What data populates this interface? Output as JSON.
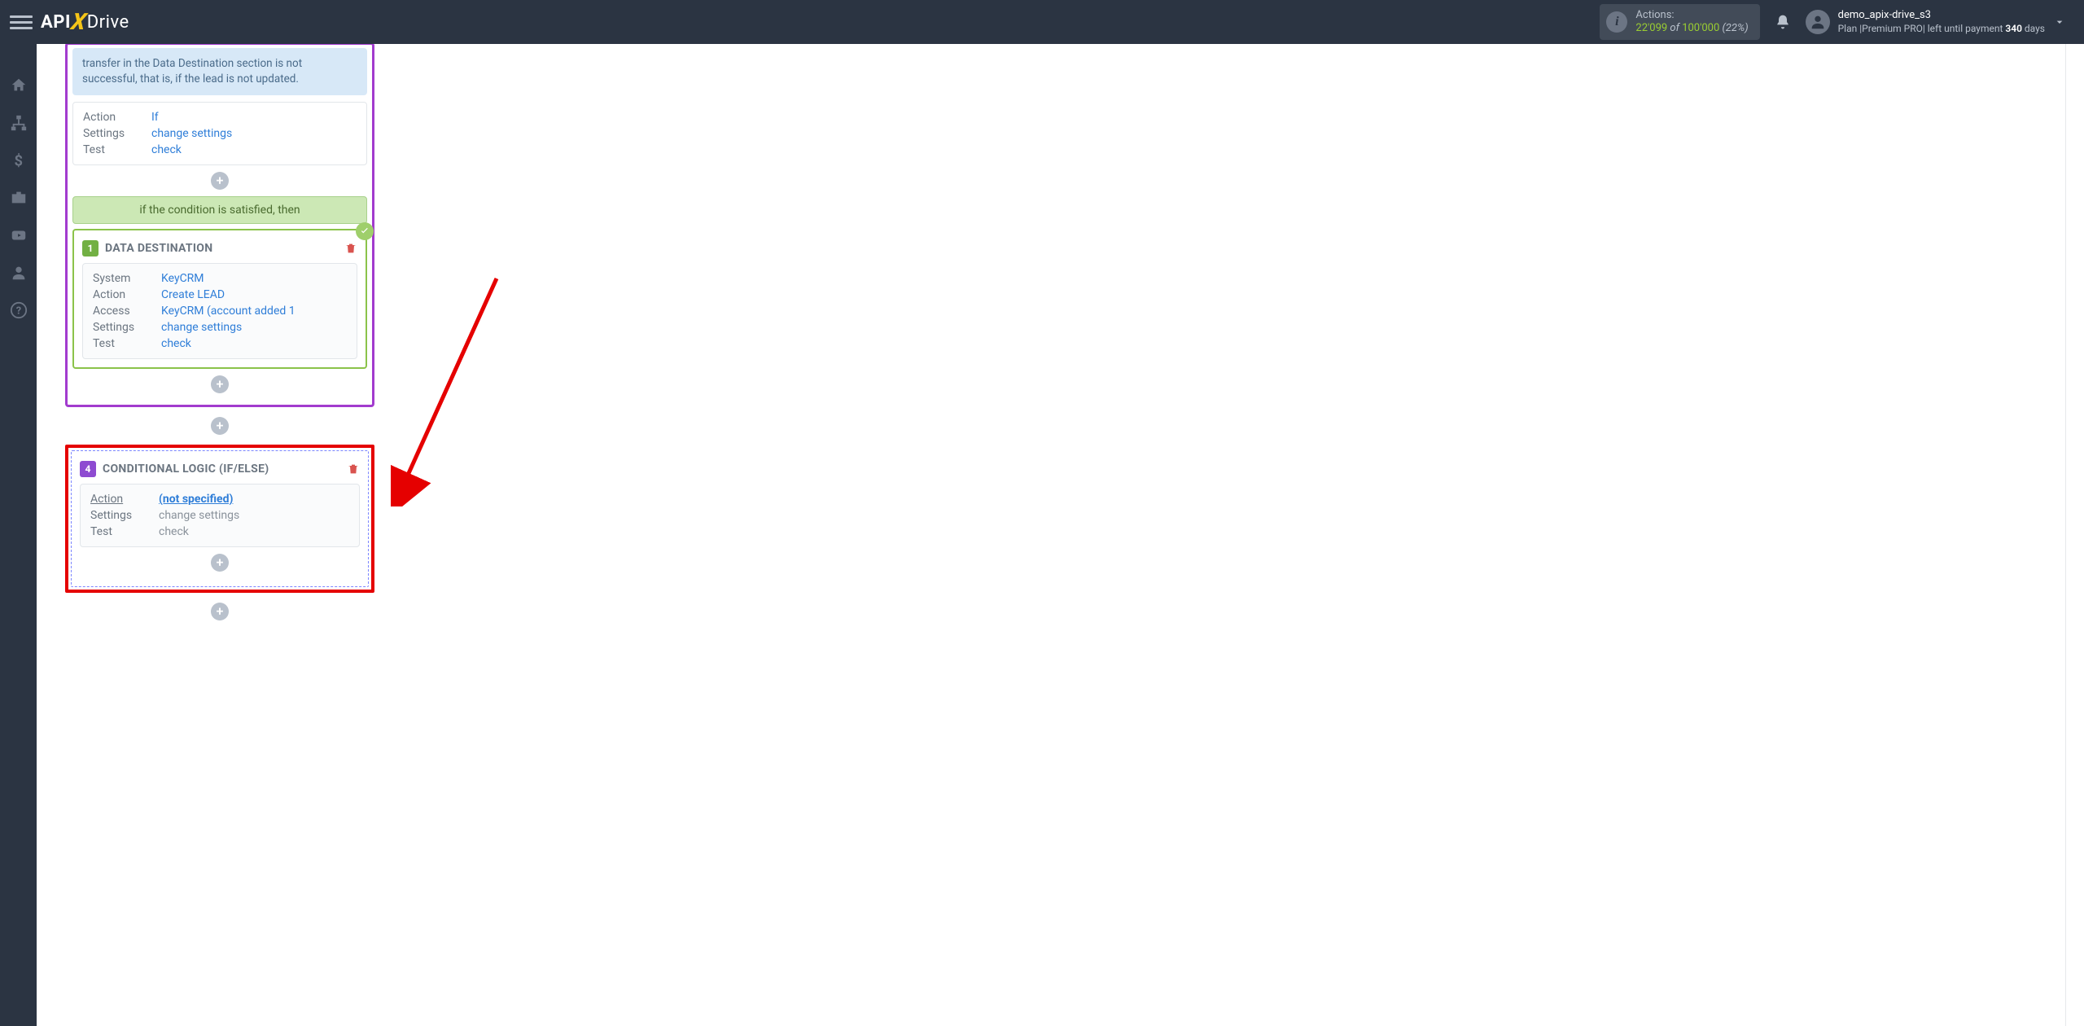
{
  "brand": {
    "api": "API",
    "x": "X",
    "drive": "Drive"
  },
  "actions": {
    "label": "Actions:",
    "current": "22'099",
    "of": " of ",
    "total": "100'000",
    "pct": " (22%)"
  },
  "user": {
    "name": "demo_apix-drive_s3",
    "plan_prefix": "Plan |",
    "plan_name": "Premium PRO",
    "plan_mid": "| left until payment ",
    "days_num": "340",
    "days_suffix": " days"
  },
  "note": {
    "text": "transfer in the Data Destination section is not successful, that is, if the lead is not updated."
  },
  "block3": {
    "rows": {
      "action_k": "Action",
      "action_v": "If",
      "settings_k": "Settings",
      "settings_v": "change settings",
      "test_k": "Test",
      "test_v": "check"
    }
  },
  "cond_banner": "if the condition is satisfied, then",
  "dest": {
    "badge": "1",
    "title": "DATA DESTINATION",
    "rows": {
      "system_k": "System",
      "system_v": "KeyCRM",
      "action_k": "Action",
      "action_v": "Create LEAD",
      "access_k": "Access",
      "access_v": "KeyCRM (account added 1",
      "settings_k": "Settings",
      "settings_v": "change settings",
      "test_k": "Test",
      "test_v": "check"
    }
  },
  "block4": {
    "badge": "4",
    "title": "CONDITIONAL LOGIC (IF/ELSE)",
    "rows": {
      "action_k": "Action",
      "action_v": "(not specified)",
      "settings_k": "Settings",
      "settings_v": "change settings",
      "test_k": "Test",
      "test_v": "check"
    }
  },
  "plus": "+"
}
